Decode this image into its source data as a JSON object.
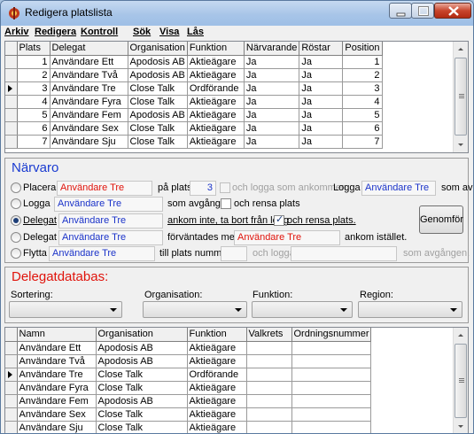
{
  "window": {
    "title": "Redigera platslista",
    "controls": [
      "minimize",
      "maximize",
      "close"
    ]
  },
  "menu": [
    "Arkiv",
    "Redigera",
    "Kontroll",
    "Sök",
    "Visa",
    "Lås"
  ],
  "seat_list": {
    "columns": [
      "Plats",
      "Delegat",
      "Organisation",
      "Funktion",
      "Närvarande",
      "Röstar",
      "Position"
    ],
    "current_row": 2,
    "rows": [
      [
        "1",
        "Användare Ett",
        "Apodosis AB",
        "Aktieägare",
        "Ja",
        "Ja",
        "1"
      ],
      [
        "2",
        "Användare Två",
        "Apodosis AB",
        "Aktieägare",
        "Ja",
        "Ja",
        "2"
      ],
      [
        "3",
        "Användare Tre",
        "Close Talk",
        "Ordförande",
        "Ja",
        "Ja",
        "3"
      ],
      [
        "4",
        "Användare Fyra",
        "Close Talk",
        "Aktieägare",
        "Ja",
        "Ja",
        "4"
      ],
      [
        "5",
        "Användare Fem",
        "Apodosis AB",
        "Aktieägare",
        "Ja",
        "Ja",
        "5"
      ],
      [
        "6",
        "Användare Sex",
        "Close Talk",
        "Aktieägare",
        "Ja",
        "Ja",
        "6"
      ],
      [
        "7",
        "Användare Sju",
        "Close Talk",
        "Aktieägare",
        "Ja",
        "Ja",
        "7"
      ]
    ]
  },
  "narvaro": {
    "title": "Närvaro",
    "placera": {
      "label": "Placera",
      "delegate": "Användare Tre",
      "on_seat": "på plats",
      "seat": "3",
      "log_arrived": "och logga som ankommen.",
      "logga_label": "Logga",
      "logga_delegate": "Användare Tre",
      "as_suffix": "som av"
    },
    "logga": {
      "label": "Logga",
      "delegate": "Användare Tre",
      "departed": "som avgången",
      "clear_seat": "och rensa plats"
    },
    "delegat1": {
      "label": "Delegat",
      "delegate": "Användare Tre",
      "not_arrived": "ankom inte, ta bort från logg",
      "clear_seat": "och rensa plats."
    },
    "delegat2": {
      "label": "Delegat",
      "delegate": "Användare Tre",
      "expected_but": "förväntades men",
      "replacement": "Användare Tre",
      "arrived_instead": "ankom istället."
    },
    "flytta": {
      "label": "Flytta",
      "delegate": "Användare Tre",
      "to_seat": "till plats nummer",
      "and_log": "och logga",
      "as_departed": "som avgången."
    },
    "execute_button": "Genomför",
    "selected_option": "delegat1",
    "colors": {
      "title": "#1a3bd1",
      "field_blue": "#1b33c9",
      "field_red": "#e0140c"
    }
  },
  "delegatdatabas": {
    "title": "Delegatdatabas:",
    "title_color": "#e0140c",
    "filters": [
      {
        "label": "Sortering:",
        "value": ""
      },
      {
        "label": "Organisation:",
        "value": ""
      },
      {
        "label": "Funktion:",
        "value": ""
      },
      {
        "label": "Region:",
        "value": ""
      }
    ],
    "columns": [
      "Namn",
      "Organisation",
      "Funktion",
      "Valkrets",
      "Ordningsnummer"
    ],
    "current_row": 2,
    "rows": [
      [
        "Användare Ett",
        "Apodosis AB",
        "Aktieägare",
        "",
        ""
      ],
      [
        "Användare Två",
        "Apodosis AB",
        "Aktieägare",
        "",
        ""
      ],
      [
        "Användare Tre",
        "Close Talk",
        "Ordförande",
        "",
        ""
      ],
      [
        "Användare Fyra",
        "Close Talk",
        "Aktieägare",
        "",
        ""
      ],
      [
        "Användare Fem",
        "Apodosis AB",
        "Aktieägare",
        "",
        ""
      ],
      [
        "Användare Sex",
        "Close Talk",
        "Aktieägare",
        "",
        ""
      ],
      [
        "Användare Sju",
        "Close Talk",
        "Aktieägare",
        "",
        ""
      ]
    ]
  }
}
